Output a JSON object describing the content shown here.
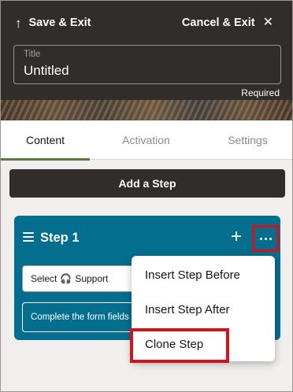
{
  "header": {
    "save_exit": "Save & Exit",
    "cancel_exit": "Cancel & Exit",
    "title_field": {
      "label": "Title",
      "value": "Untitled"
    },
    "required": "Required"
  },
  "tabs": [
    {
      "label": "Content",
      "active": true
    },
    {
      "label": "Activation",
      "active": false
    },
    {
      "label": "Settings",
      "active": false
    }
  ],
  "add_step_label": "Add a Step",
  "step": {
    "title": "Step 1",
    "plus": "+",
    "select_value": "Select",
    "select_icon": "headset-icon",
    "select_suffix": "Support",
    "note": "Complete the form fields"
  },
  "menu": {
    "items": [
      "Insert Step Before",
      "Insert Step After",
      "Clone Step"
    ]
  },
  "colors": {
    "header_bg": "#312d2a",
    "step_card_bg": "#046e8f",
    "highlight": "#d4121b",
    "active_tab_underline": "#5a7a3e"
  }
}
